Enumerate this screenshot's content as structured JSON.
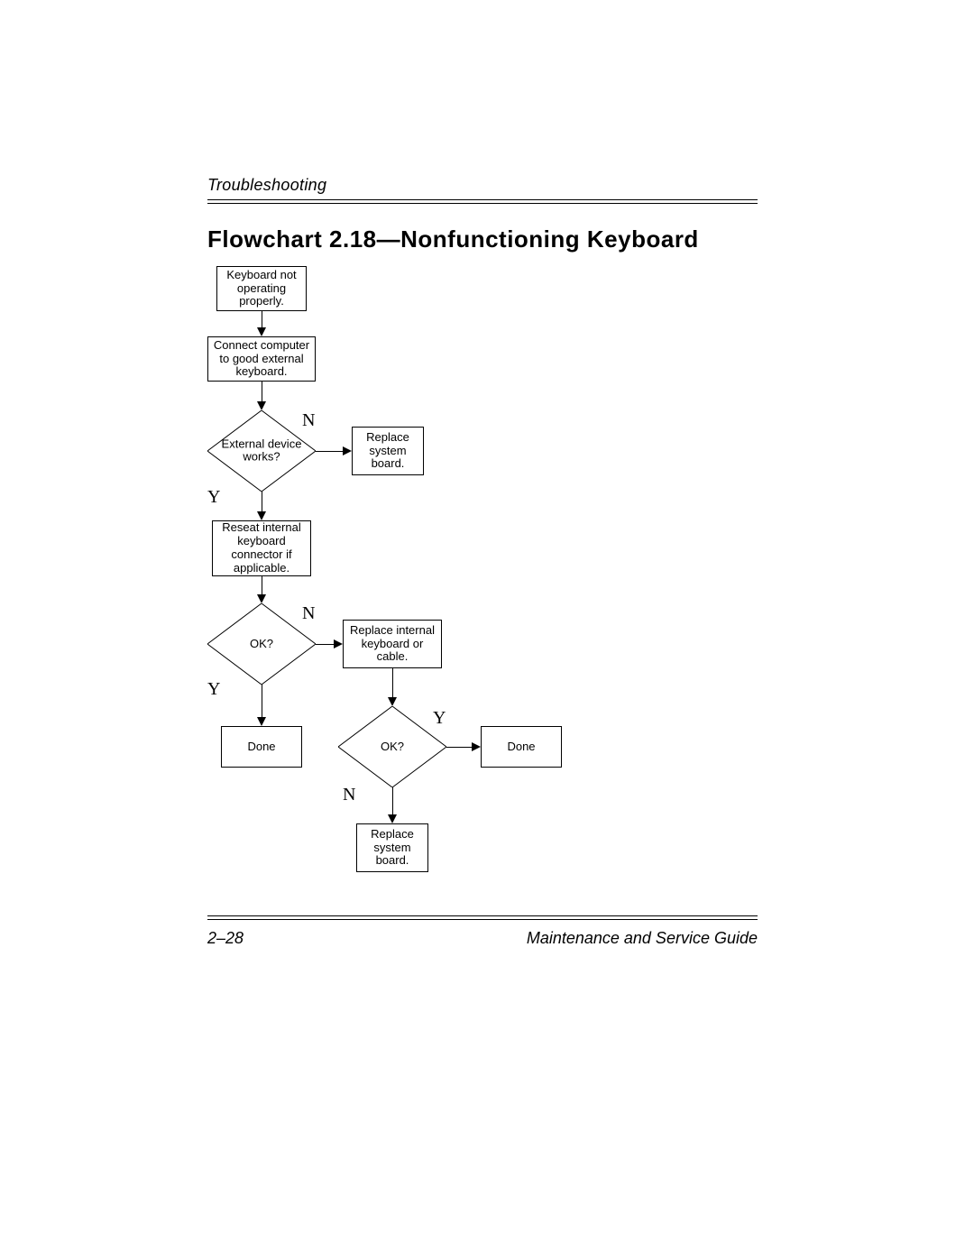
{
  "header": {
    "section": "Troubleshooting",
    "title": "Flowchart 2.18—Nonfunctioning Keyboard"
  },
  "footer": {
    "page": "2–28",
    "guide": "Maintenance and Service Guide"
  },
  "chart_data": {
    "type": "flowchart",
    "nodes": {
      "start": {
        "shape": "process",
        "text": "Keyboard not operating properly."
      },
      "connect": {
        "shape": "process",
        "text": "Connect computer to good external keyboard."
      },
      "ext_works": {
        "shape": "decision",
        "text": "External device works?"
      },
      "replace_sb1": {
        "shape": "process",
        "text": "Replace system board."
      },
      "reseat": {
        "shape": "process",
        "text": "Reseat internal keyboard connector if applicable."
      },
      "ok1": {
        "shape": "decision",
        "text": "OK?"
      },
      "replace_kb": {
        "shape": "process",
        "text": "Replace internal keyboard or cable."
      },
      "done1": {
        "shape": "terminal",
        "text": "Done"
      },
      "ok2": {
        "shape": "decision",
        "text": "OK?"
      },
      "done2": {
        "shape": "terminal",
        "text": "Done"
      },
      "replace_sb2": {
        "shape": "process",
        "text": "Replace system board."
      }
    },
    "edges": [
      {
        "from": "start",
        "to": "connect",
        "label": ""
      },
      {
        "from": "connect",
        "to": "ext_works",
        "label": ""
      },
      {
        "from": "ext_works",
        "to": "replace_sb1",
        "label": "N"
      },
      {
        "from": "ext_works",
        "to": "reseat",
        "label": "Y"
      },
      {
        "from": "reseat",
        "to": "ok1",
        "label": ""
      },
      {
        "from": "ok1",
        "to": "replace_kb",
        "label": "N"
      },
      {
        "from": "ok1",
        "to": "done1",
        "label": "Y"
      },
      {
        "from": "replace_kb",
        "to": "ok2",
        "label": ""
      },
      {
        "from": "ok2",
        "to": "done2",
        "label": "Y"
      },
      {
        "from": "ok2",
        "to": "replace_sb2",
        "label": "N"
      }
    ],
    "labels": {
      "yes": "Y",
      "no": "N"
    }
  }
}
